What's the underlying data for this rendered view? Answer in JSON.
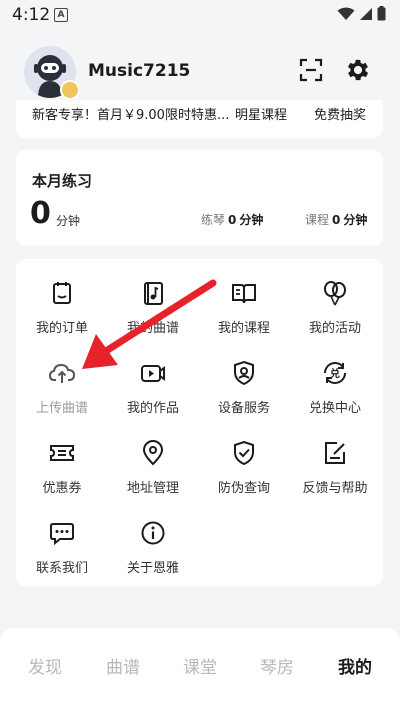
{
  "status_bar": {
    "time": "4:12",
    "notification_icon": "A"
  },
  "profile": {
    "username": "Music7215"
  },
  "promo": {
    "items": [
      "新客专享！首月￥9.00限时特惠...",
      "明星课程",
      "免费抽奖"
    ]
  },
  "practice": {
    "title": "本月练习",
    "total_value": "0",
    "total_unit": "分钟",
    "piano_label": "练琴",
    "piano_value": "0",
    "piano_unit": "分钟",
    "course_label": "课程",
    "course_value": "0",
    "course_unit": "分钟"
  },
  "menu": {
    "items": [
      {
        "label": "我的订单",
        "icon": "order-clipboard-icon"
      },
      {
        "label": "我的曲谱",
        "icon": "music-score-icon"
      },
      {
        "label": "我的课程",
        "icon": "open-book-icon"
      },
      {
        "label": "我的活动",
        "icon": "balloons-icon"
      },
      {
        "label": "上传曲谱",
        "icon": "cloud-upload-icon"
      },
      {
        "label": "我的作品",
        "icon": "video-play-icon"
      },
      {
        "label": "设备服务",
        "icon": "device-shield-icon"
      },
      {
        "label": "兑换中心",
        "icon": "exchange-icon"
      },
      {
        "label": "优惠券",
        "icon": "coupon-icon"
      },
      {
        "label": "地址管理",
        "icon": "location-pin-icon"
      },
      {
        "label": "防伪查询",
        "icon": "shield-check-icon"
      },
      {
        "label": "反馈与帮助",
        "icon": "feedback-edit-icon"
      },
      {
        "label": "联系我们",
        "icon": "chat-bubble-icon"
      },
      {
        "label": "关于恩雅",
        "icon": "info-circle-icon"
      }
    ]
  },
  "tabs": [
    {
      "label": "发现",
      "active": false
    },
    {
      "label": "曲谱",
      "active": false
    },
    {
      "label": "课堂",
      "active": false
    },
    {
      "label": "琴房",
      "active": false
    },
    {
      "label": "我的",
      "active": true
    }
  ],
  "colors": {
    "annotation_arrow": "#e8222a",
    "background": "#f4f5f7",
    "card": "#ffffff"
  }
}
